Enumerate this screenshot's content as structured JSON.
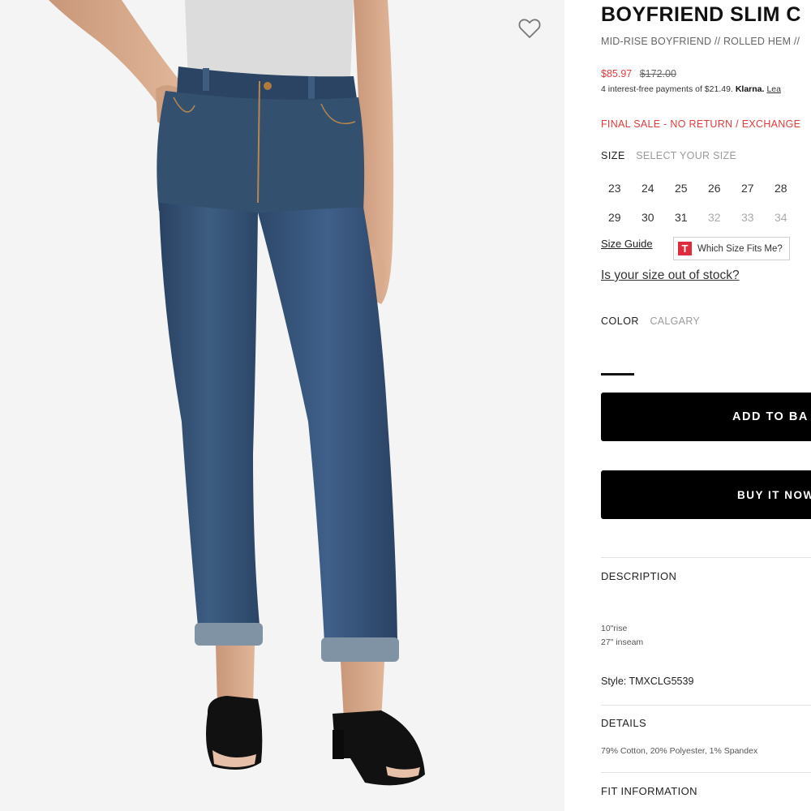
{
  "product": {
    "title": "BOYFRIEND SLIM C",
    "subtitle": "MID-RISE BOYFRIEND // ROLLED HEM //",
    "price_sale": "$85.97",
    "price_original": "$172.00",
    "klarna": {
      "text": "4 interest-free payments of $21.49.",
      "brand": "Klarna.",
      "link": "Lea"
    },
    "final_sale": "FINAL SALE - NO RETURN / EXCHANGE"
  },
  "size": {
    "label": "SIZE",
    "prompt": "SELECT YOUR SIZE",
    "options": [
      {
        "value": "23",
        "available": true
      },
      {
        "value": "24",
        "available": true
      },
      {
        "value": "25",
        "available": true
      },
      {
        "value": "26",
        "available": true
      },
      {
        "value": "27",
        "available": true
      },
      {
        "value": "28",
        "available": true
      },
      {
        "value": "29",
        "available": true
      },
      {
        "value": "30",
        "available": true
      },
      {
        "value": "31",
        "available": true
      },
      {
        "value": "32",
        "available": false
      },
      {
        "value": "33",
        "available": false
      },
      {
        "value": "34",
        "available": false
      }
    ],
    "guide_label": "Size Guide",
    "fit_finder_label": "Which Size Fits Me?",
    "fit_finder_logo": "T",
    "out_of_stock_link": "Is your size out of stock?"
  },
  "color": {
    "label": "COLOR",
    "value": "CALGARY"
  },
  "actions": {
    "add_to_bag": "ADD TO BA",
    "buy_now": "BUY IT NOW"
  },
  "description": {
    "heading": "DESCRIPTION",
    "rise": "10\"rise",
    "inseam": "27\" inseam",
    "style": "Style: TMXCLG5539"
  },
  "details": {
    "heading": "DETAILS",
    "fabric": "79% Cotton, 20% Polyester, 1% Spandex"
  },
  "fit": {
    "heading": "FIT INFORMATION"
  },
  "icons": {
    "wishlist": "heart-outline-icon"
  },
  "colors": {
    "sale_red": "#e23b3b",
    "button_black": "#000000",
    "denim": "#2f4a68"
  }
}
